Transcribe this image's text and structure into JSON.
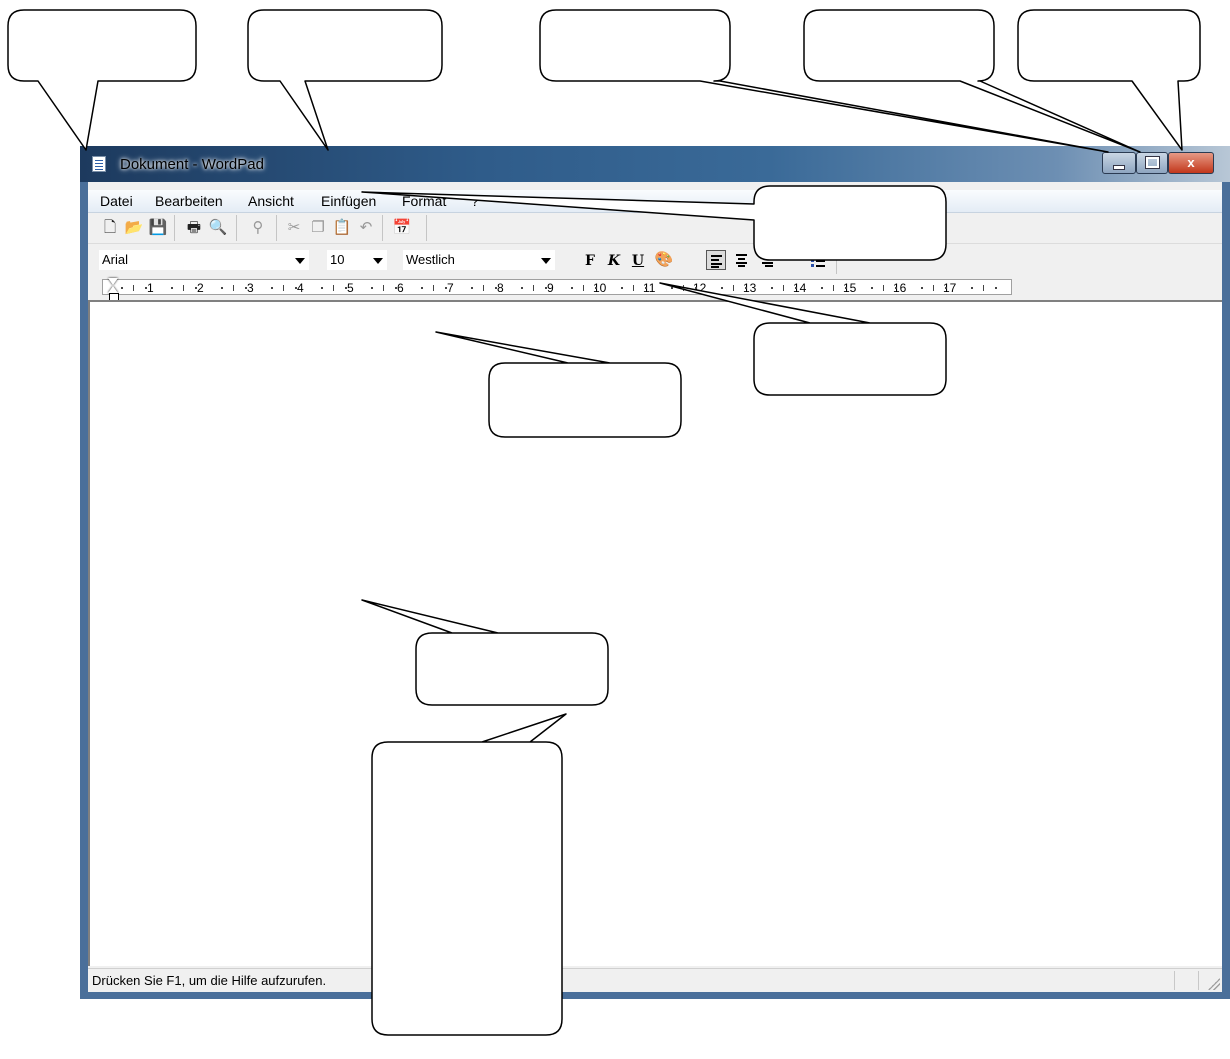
{
  "window": {
    "title": "Dokument - WordPad",
    "close_label": "x"
  },
  "menu": {
    "items": [
      "Datei",
      "Bearbeiten",
      "Ansicht",
      "Einfügen",
      "Format",
      "?"
    ]
  },
  "toolbar": {
    "icons": [
      "new-document-icon",
      "open-folder-icon",
      "save-disk-icon",
      "print-icon",
      "print-preview-icon",
      "find-binoculars-icon",
      "cut-scissors-icon",
      "copy-icon",
      "paste-icon",
      "undo-icon",
      "insert-datetime-icon"
    ]
  },
  "format_bar": {
    "font": "Arial",
    "size": "10",
    "script": "Westlich",
    "bold_label": "F",
    "italic_label": "K",
    "underline_label": "U"
  },
  "ruler": {
    "numbers": [
      "1",
      "2",
      "3",
      "4",
      "5",
      "6",
      "7",
      "8",
      "9",
      "10",
      "11",
      "12",
      "13",
      "14",
      "15",
      "16",
      "17"
    ]
  },
  "status": {
    "text": "Drücken Sie F1, um die Hilfe aufzurufen."
  },
  "colors": {
    "title_gradient_start": "#1d3a5e",
    "close_button": "#c2371b"
  }
}
